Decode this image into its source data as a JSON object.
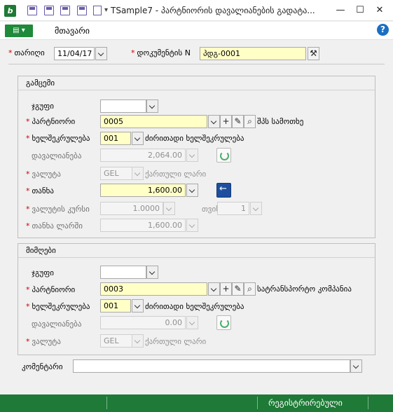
{
  "window": {
    "title": "TSample7 - პარტნიორის დავალიანების გადატა...",
    "minimize": "—",
    "maximize": "☐",
    "close": "✕"
  },
  "menu": {
    "menu_button": "▤ ▾",
    "main_label": "მთავარი",
    "help": "?"
  },
  "header": {
    "date_label": "თარიღი",
    "date_value": "11/04/17",
    "doc_label": "დოკუმენტის N",
    "doc_value": "პდგ-0001"
  },
  "issuer": {
    "title": "გამცემი",
    "group_label": "ჯგუფი",
    "group_value": "",
    "partner_label": "პარტნიორი",
    "partner_value": "0005",
    "partner_name": "შპს სამოთხე",
    "contract_label": "ხელშეკრულება",
    "contract_value": "001",
    "contract_name": "ძირითადი ხელშეკრულება",
    "debt_label": "დავალიანება",
    "debt_value": "2,064.00",
    "currency_label": "ვალუტა",
    "currency_value": "GEL",
    "currency_name": "ქართული ლარი",
    "amount_label": "თანხა",
    "amount_value": "1,600.00",
    "rate_label": "ვალუტის კურსი",
    "rate_value": "1.0000",
    "per_label": "თვის",
    "per_value": "1",
    "amount_gel_label": "თანხა ლარში",
    "amount_gel_value": "1,600.00"
  },
  "receiver": {
    "title": "მიმღები",
    "group_label": "ჯგუფი",
    "group_value": "",
    "partner_label": "პარტნიორი",
    "partner_value": "0003",
    "partner_name": "სატრანსპორტო კომპანია",
    "contract_label": "ხელშეკრულება",
    "contract_value": "001",
    "contract_name": "ძირითადი ხელშეკრულება",
    "debt_label": "დავალიანება",
    "debt_value": "0.00",
    "currency_label": "ვალუტა",
    "currency_value": "GEL",
    "currency_name": "ქართული ლარი"
  },
  "comment": {
    "label": "კომენტარი",
    "value": ""
  },
  "status": {
    "text": "რეგისტრირებული"
  },
  "colors": {
    "accent_green": "#1e7a36",
    "required_yellow": "#ffffc6",
    "required_star": "#d00000"
  }
}
